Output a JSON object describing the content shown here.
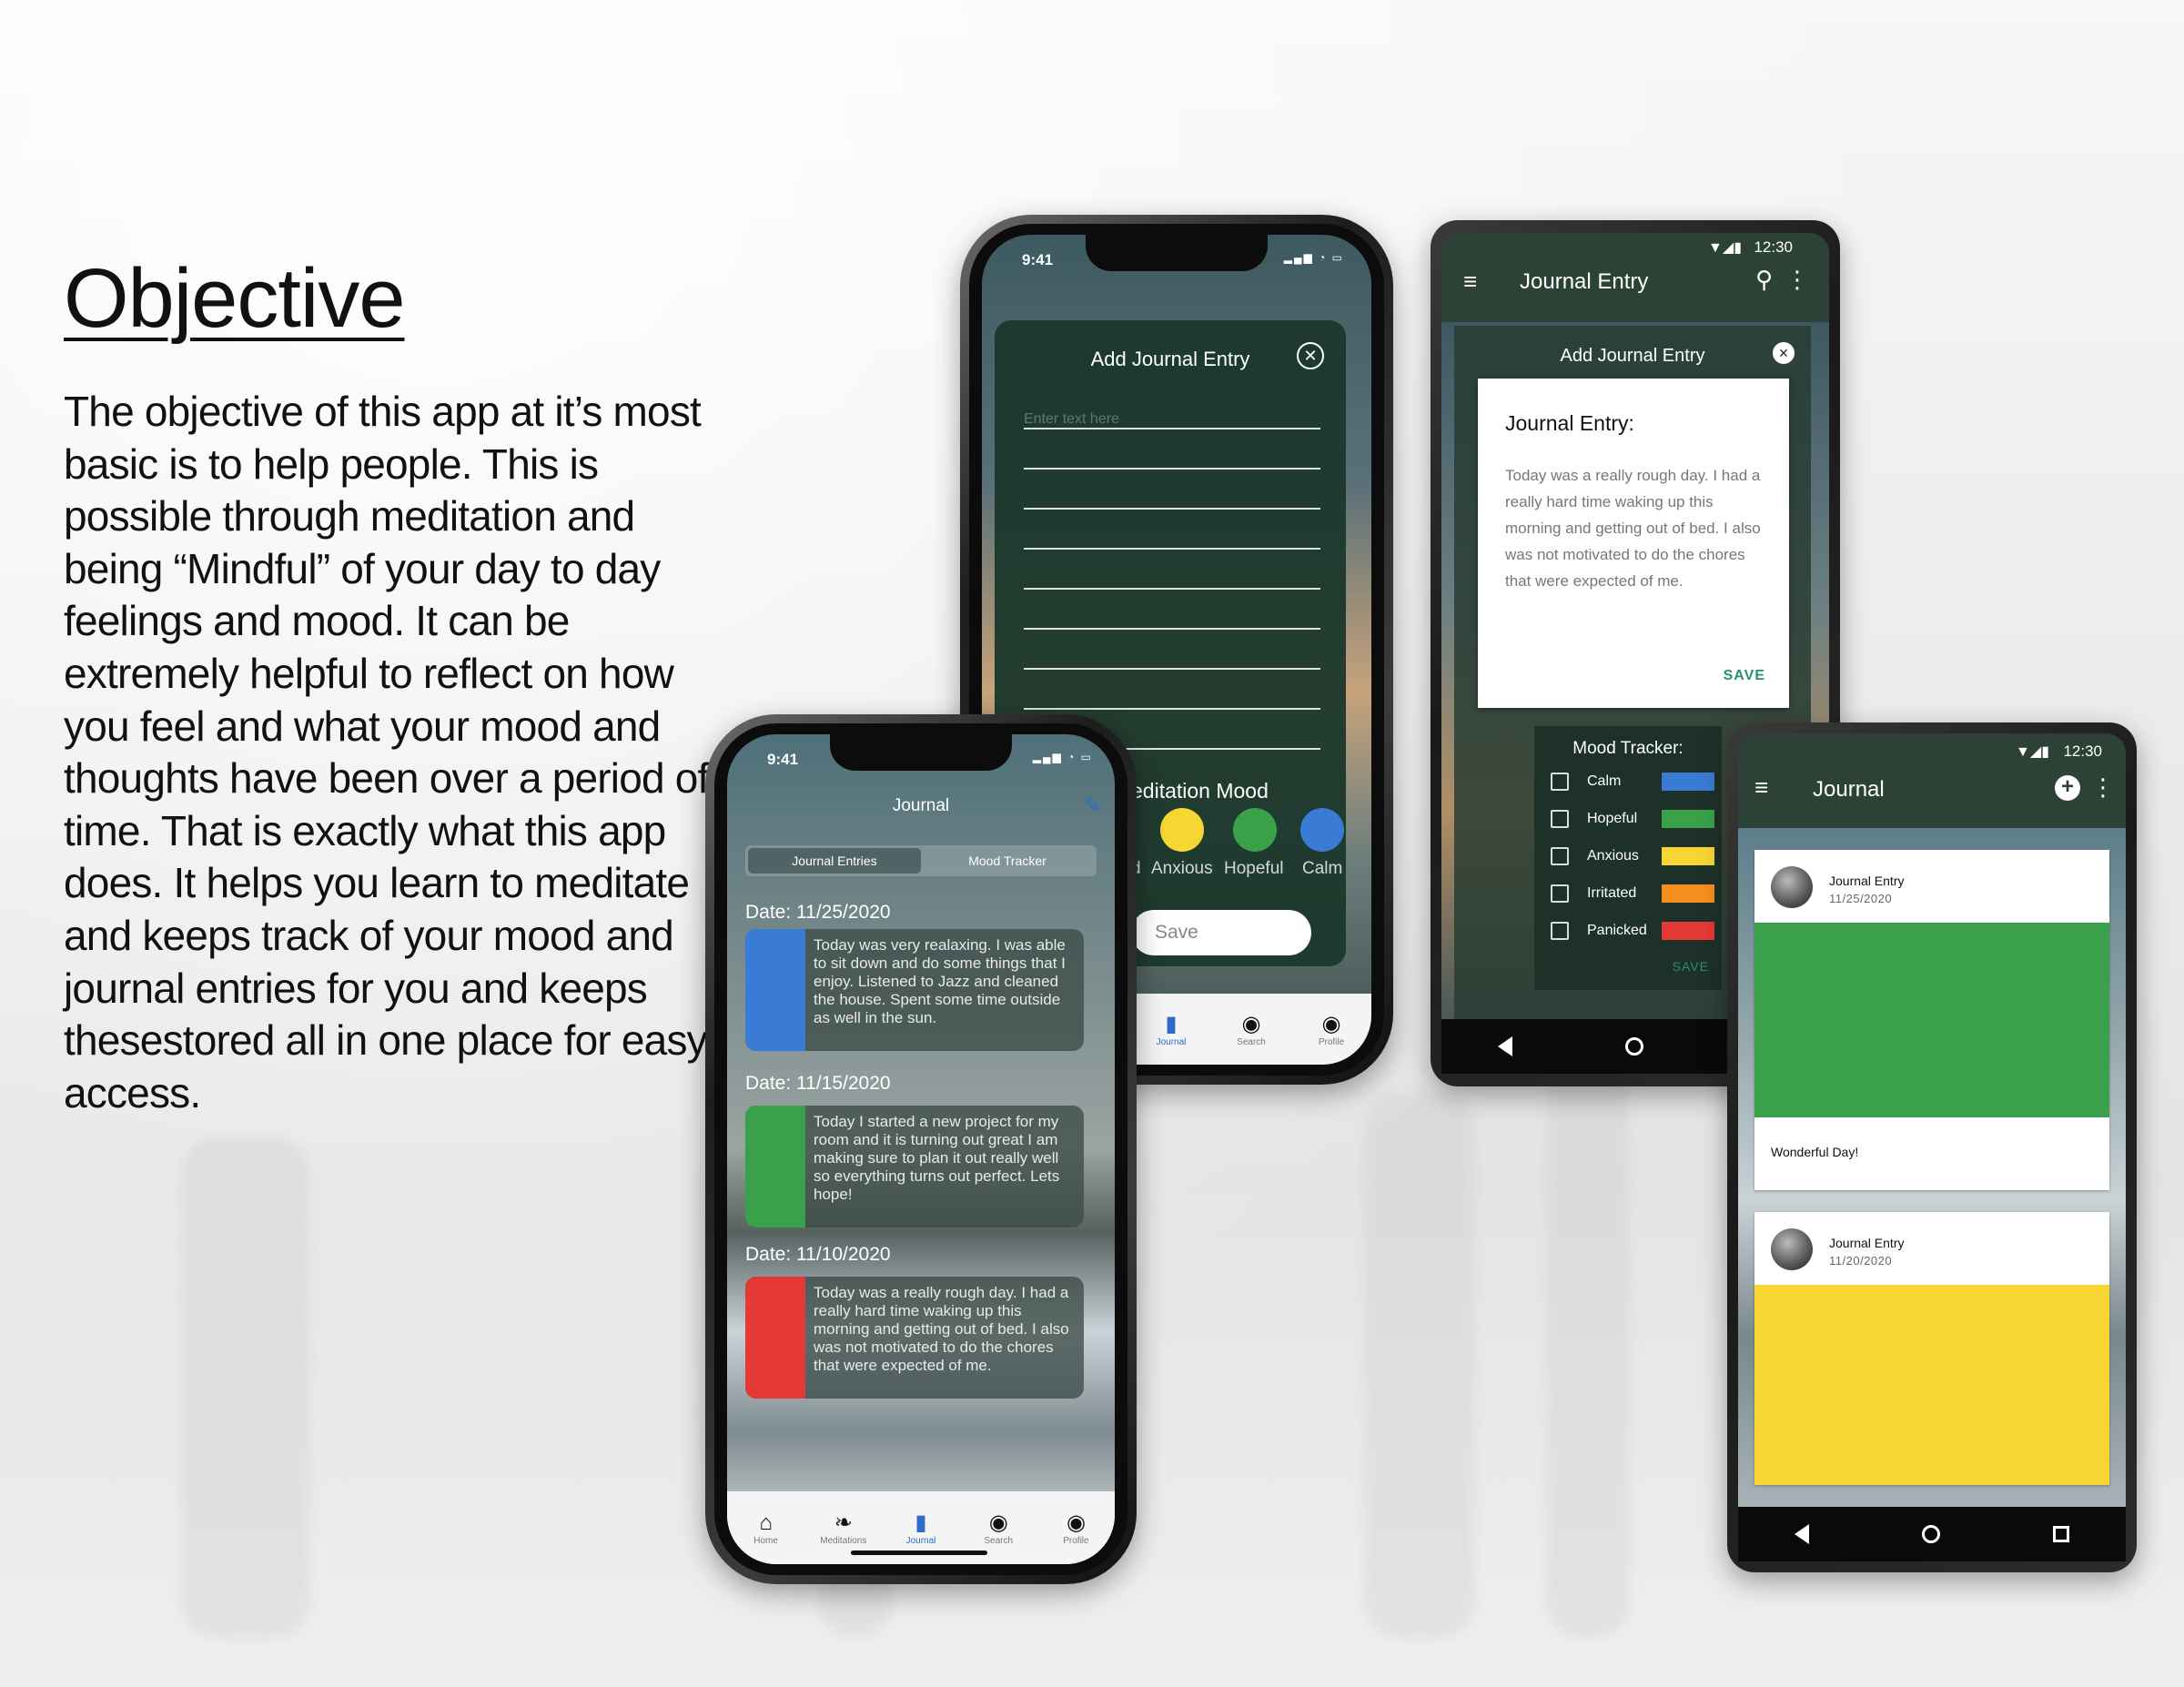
{
  "colors": {
    "accent_green": "#2b4b3c",
    "calm_blue": "#3a7bd5",
    "hopeful_green": "#3aa14a",
    "anxious_yellow": "#f7d633",
    "irritated_orange": "#f78f1e",
    "panicked_red": "#e53935",
    "active_tab_blue": "#2d6cc7"
  },
  "objective": {
    "title": "Objective",
    "body": "The objective of this app at it’s most basic is to help people. This is possible through meditation and being “Mindful” of your day to day feelings and mood. It can be extremely helpful to reflect on how you feel and what your mood and thoughts have been over a period of time. That is exactly what this app does. It helps you learn to meditate and keeps track of your mood and journal entries for you and keeps thesestored all in one place for easy access."
  },
  "iphone_add": {
    "time": "9:41",
    "modal_title": "Add Journal Entry",
    "close_icon": "close-circle-icon",
    "placeholder": "Enter text here",
    "mood_heading": "editation Mood",
    "moods": [
      {
        "label": "d",
        "color": "#f7d633"
      },
      {
        "label": "Anxious",
        "color": "#f7d633"
      },
      {
        "label": "Hopeful",
        "color": "#3aa14a"
      },
      {
        "label": "Calm",
        "color": "#3a7bd5"
      }
    ],
    "save_placeholder": "Save",
    "tabs": [
      {
        "label": "Journal",
        "icon": "book-icon"
      },
      {
        "label": "Search",
        "icon": "search-icon"
      },
      {
        "label": "Profile",
        "icon": "profile-icon"
      }
    ]
  },
  "android_entry": {
    "time": "12:30",
    "app_title": "Journal Entry",
    "dialog_title": "Add Journal Entry",
    "card_heading": "Journal Entry:",
    "card_text": "Today was a really rough day. I had a really hard time waking up this morning and getting out of bed. I also was not motivated to do the chores that were expected of me.",
    "save_label": "SAVE",
    "mood_tracker_title": "Mood Tracker:",
    "mood_rows": [
      {
        "label": "Calm",
        "color": "#3a7bd5"
      },
      {
        "label": "Hopeful",
        "color": "#3aa14a"
      },
      {
        "label": "Anxious",
        "color": "#f7d633"
      },
      {
        "label": "Irritated",
        "color": "#f78f1e"
      },
      {
        "label": "Panicked",
        "color": "#e53935"
      }
    ],
    "mood_save_label": "SAVE"
  },
  "iphone_journal": {
    "time": "9:41",
    "title": "Journal",
    "segments": [
      "Journal Entries",
      "Mood Tracker"
    ],
    "entries": [
      {
        "date": "Date: 11/25/2020",
        "color": "#3a7bd5",
        "text": "Today was very realaxing. I was able to sit down and do some things that I enjoy. Listened to Jazz and cleaned the house. Spent some time outside as well in the sun."
      },
      {
        "date": "Date: 11/15/2020",
        "color": "#3aa14a",
        "text": "Today I started a new project for my room and it is turning out great I am making sure to plan it out really well so everything turns out perfect. Lets hope!"
      },
      {
        "date": "Date: 11/10/2020",
        "color": "#e53935",
        "text": "Today was a really rough day. I had a really hard time waking up this morning and getting out of bed. I also was not motivated to do the chores that were expected of me."
      }
    ],
    "tabs": [
      {
        "label": "Home",
        "icon": "home-icon"
      },
      {
        "label": "Meditations",
        "icon": "leaf-icon"
      },
      {
        "label": "Journal",
        "icon": "book-icon"
      },
      {
        "label": "Search",
        "icon": "search-icon"
      },
      {
        "label": "Profile",
        "icon": "profile-icon"
      }
    ]
  },
  "android_feed": {
    "time": "12:30",
    "app_title": "Journal",
    "cards": [
      {
        "title": "Journal Entry",
        "date": "11/25/2020",
        "color": "#3aa14a",
        "caption": "Wonderful Day!"
      },
      {
        "title": "Journal Entry",
        "date": "11/20/2020",
        "color": "#f7d633",
        "caption": ""
      }
    ]
  }
}
